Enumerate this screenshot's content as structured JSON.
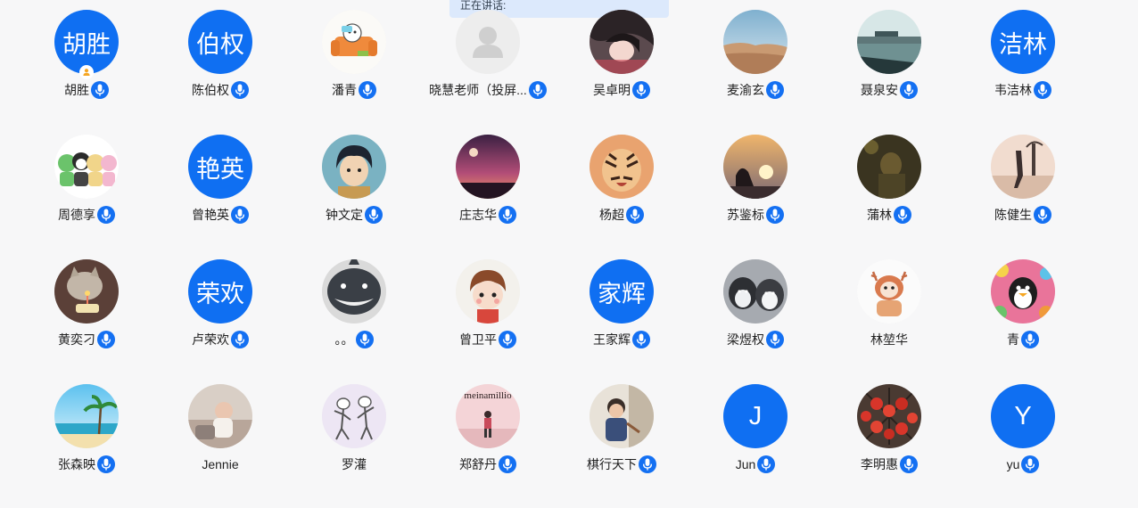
{
  "speaking_banner": {
    "label": "正在讲话:"
  },
  "participants": [
    {
      "name": "胡胜",
      "avatar_type": "text",
      "avatar_text": "胡胜",
      "mic": true,
      "host": true
    },
    {
      "name": "陈伯权",
      "avatar_type": "text",
      "avatar_text": "伯权",
      "mic": true
    },
    {
      "name": "潘青",
      "avatar_type": "image",
      "avatar_icon": "cartoon-sofa-avatar-icon",
      "mic": true
    },
    {
      "name": "晓慧老师（投屏...",
      "avatar_type": "image",
      "avatar_icon": "default-user-avatar-icon",
      "mic": true
    },
    {
      "name": "吴卓明",
      "avatar_type": "image",
      "avatar_icon": "anime-girl-avatar-icon",
      "mic": true
    },
    {
      "name": "麦渝玄",
      "avatar_type": "image",
      "avatar_icon": "desert-landscape-avatar-icon",
      "mic": true
    },
    {
      "name": "聂泉安",
      "avatar_type": "image",
      "avatar_icon": "harbor-landscape-avatar-icon",
      "mic": true
    },
    {
      "name": "韦洁林",
      "avatar_type": "text",
      "avatar_text": "洁林",
      "mic": true
    },
    {
      "name": "周德享",
      "avatar_type": "image",
      "avatar_icon": "cartoon-animals-avatar-icon",
      "mic": true
    },
    {
      "name": "曾艳英",
      "avatar_type": "text",
      "avatar_text": "艳英",
      "mic": true
    },
    {
      "name": "钟文定",
      "avatar_type": "image",
      "avatar_icon": "anime-boy-avatar-icon",
      "mic": true
    },
    {
      "name": "庄志华",
      "avatar_type": "image",
      "avatar_icon": "sunset-sky-avatar-icon",
      "mic": true
    },
    {
      "name": "杨超",
      "avatar_type": "image",
      "avatar_icon": "tiger-avatar-icon",
      "mic": true
    },
    {
      "name": "苏鉴标",
      "avatar_type": "image",
      "avatar_icon": "sunset-person-avatar-icon",
      "mic": true
    },
    {
      "name": "蒲林",
      "avatar_type": "image",
      "avatar_icon": "dark-photo-avatar-icon",
      "mic": true
    },
    {
      "name": "陈健生",
      "avatar_type": "image",
      "avatar_icon": "beach-person-avatar-icon",
      "mic": true
    },
    {
      "name": "黄奕刁",
      "avatar_type": "image",
      "avatar_icon": "cat-birthday-avatar-icon",
      "mic": true
    },
    {
      "name": "卢荣欢",
      "avatar_type": "text",
      "avatar_text": "荣欢",
      "mic": true
    },
    {
      "name": "。。",
      "avatar_type": "image",
      "avatar_icon": "shark-avatar-icon",
      "mic": true
    },
    {
      "name": "曾卫平",
      "avatar_type": "image",
      "avatar_icon": "cartoon-child-avatar-icon",
      "mic": true
    },
    {
      "name": "王家辉",
      "avatar_type": "text",
      "avatar_text": "家辉",
      "mic": true
    },
    {
      "name": "梁煜权",
      "avatar_type": "image",
      "avatar_icon": "husky-dogs-avatar-icon",
      "mic": true
    },
    {
      "name": "林堃华",
      "avatar_type": "image",
      "avatar_icon": "deer-costume-avatar-icon",
      "mic": false
    },
    {
      "name": "青",
      "avatar_type": "image",
      "avatar_icon": "penguin-colorful-avatar-icon",
      "mic": true
    },
    {
      "name": "张森映",
      "avatar_type": "image",
      "avatar_icon": "beach-island-avatar-icon",
      "mic": true
    },
    {
      "name": "Jennie",
      "avatar_type": "image",
      "avatar_icon": "baby-photo-avatar-icon",
      "mic": false
    },
    {
      "name": "罗灌",
      "avatar_type": "image",
      "avatar_icon": "dancing-bears-avatar-icon",
      "mic": false
    },
    {
      "name": "郑舒丹",
      "avatar_type": "image",
      "avatar_icon": "girl-pink-wall-avatar-icon",
      "mic": true,
      "avatar_caption": "meinamillio"
    },
    {
      "name": "棋行天下",
      "avatar_type": "image",
      "avatar_icon": "kid-photo-avatar-icon",
      "mic": true
    },
    {
      "name": "Jun",
      "avatar_type": "letter",
      "avatar_text": "J",
      "mic": true
    },
    {
      "name": "李明惠",
      "avatar_type": "image",
      "avatar_icon": "red-berries-avatar-icon",
      "mic": true
    },
    {
      "name": "yu",
      "avatar_type": "letter",
      "avatar_text": "Y",
      "mic": true
    }
  ],
  "colors": {
    "accent": "#1470f2",
    "text_avatar_bg": "#0f6ff2",
    "banner_bg": "#dce9fc",
    "page_bg": "#f7f7f8",
    "host_badge": "#f5a623"
  }
}
